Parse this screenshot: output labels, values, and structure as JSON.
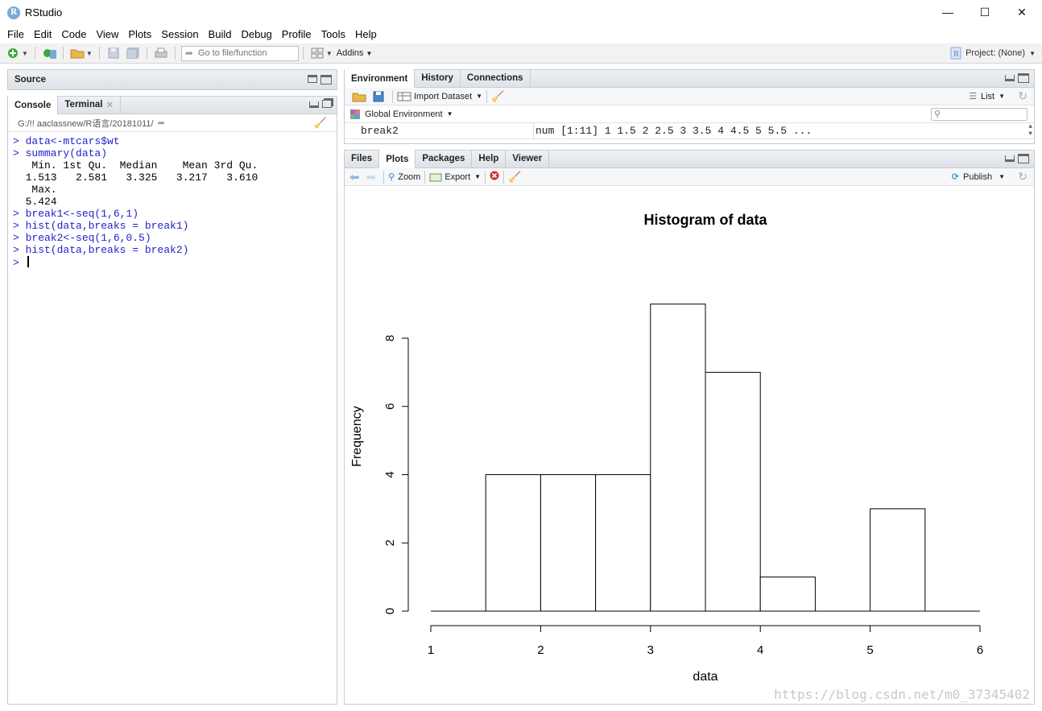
{
  "window": {
    "title": "RStudio",
    "logo_letter": "R",
    "minimize": "—",
    "maximize": "☐",
    "close": "✕"
  },
  "menu": [
    "File",
    "Edit",
    "Code",
    "View",
    "Plots",
    "Session",
    "Build",
    "Debug",
    "Profile",
    "Tools",
    "Help"
  ],
  "toolbar": {
    "goto_placeholder": "Go to file/function",
    "addins_label": "Addins",
    "project_label": "Project: (None)"
  },
  "source_pane": {
    "title": "Source"
  },
  "console_pane": {
    "tabs": [
      "Console",
      "Terminal"
    ],
    "path": "G:/!! aaclassnew/R语言/20181011/",
    "lines": [
      {
        "type": "cmd",
        "text": "> data<-mtcars$wt"
      },
      {
        "type": "cmd",
        "text": "> summary(data)"
      },
      {
        "type": "out",
        "text": "   Min. 1st Qu.  Median    Mean 3rd Qu. "
      },
      {
        "type": "out",
        "text": "  1.513   2.581   3.325   3.217   3.610 "
      },
      {
        "type": "out",
        "text": "   Max. "
      },
      {
        "type": "out",
        "text": "  5.424 "
      },
      {
        "type": "cmd",
        "text": "> break1<-seq(1,6,1)"
      },
      {
        "type": "cmd",
        "text": "> hist(data,breaks = break1)"
      },
      {
        "type": "cmd",
        "text": "> break2<-seq(1,6,0.5)"
      },
      {
        "type": "cmd",
        "text": "> hist(data,breaks = break2)"
      },
      {
        "type": "cmd",
        "text": "> "
      }
    ]
  },
  "env_pane": {
    "tabs": [
      "Environment",
      "History",
      "Connections"
    ],
    "import_label": "Import Dataset",
    "list_label": "List",
    "global_env_label": "Global Environment",
    "row": {
      "name": "break2",
      "value": "num [1:11] 1 1.5 2 2.5 3 3.5 4 4.5 5 5.5 ..."
    }
  },
  "files_pane": {
    "tabs": [
      "Files",
      "Plots",
      "Packages",
      "Help",
      "Viewer"
    ],
    "zoom_label": "Zoom",
    "export_label": "Export",
    "publish_label": "Publish"
  },
  "chart_data": {
    "type": "bar",
    "title": "Histogram of data",
    "xlabel": "data",
    "ylabel": "Frequency",
    "bins": [
      {
        "from": 1.0,
        "to": 1.5,
        "count": 0
      },
      {
        "from": 1.5,
        "to": 2.0,
        "count": 4
      },
      {
        "from": 2.0,
        "to": 2.5,
        "count": 4
      },
      {
        "from": 2.5,
        "to": 3.0,
        "count": 4
      },
      {
        "from": 3.0,
        "to": 3.5,
        "count": 9
      },
      {
        "from": 3.5,
        "to": 4.0,
        "count": 7
      },
      {
        "from": 4.0,
        "to": 4.5,
        "count": 1
      },
      {
        "from": 4.5,
        "to": 5.0,
        "count": 0
      },
      {
        "from": 5.0,
        "to": 5.5,
        "count": 3
      },
      {
        "from": 5.5,
        "to": 6.0,
        "count": 0
      }
    ],
    "xticks": [
      1,
      2,
      3,
      4,
      5,
      6
    ],
    "yticks": [
      0,
      2,
      4,
      6,
      8
    ],
    "xlim": [
      1,
      6
    ],
    "ylim": [
      0,
      8
    ]
  },
  "watermark": "https://blog.csdn.net/m0_37345402"
}
